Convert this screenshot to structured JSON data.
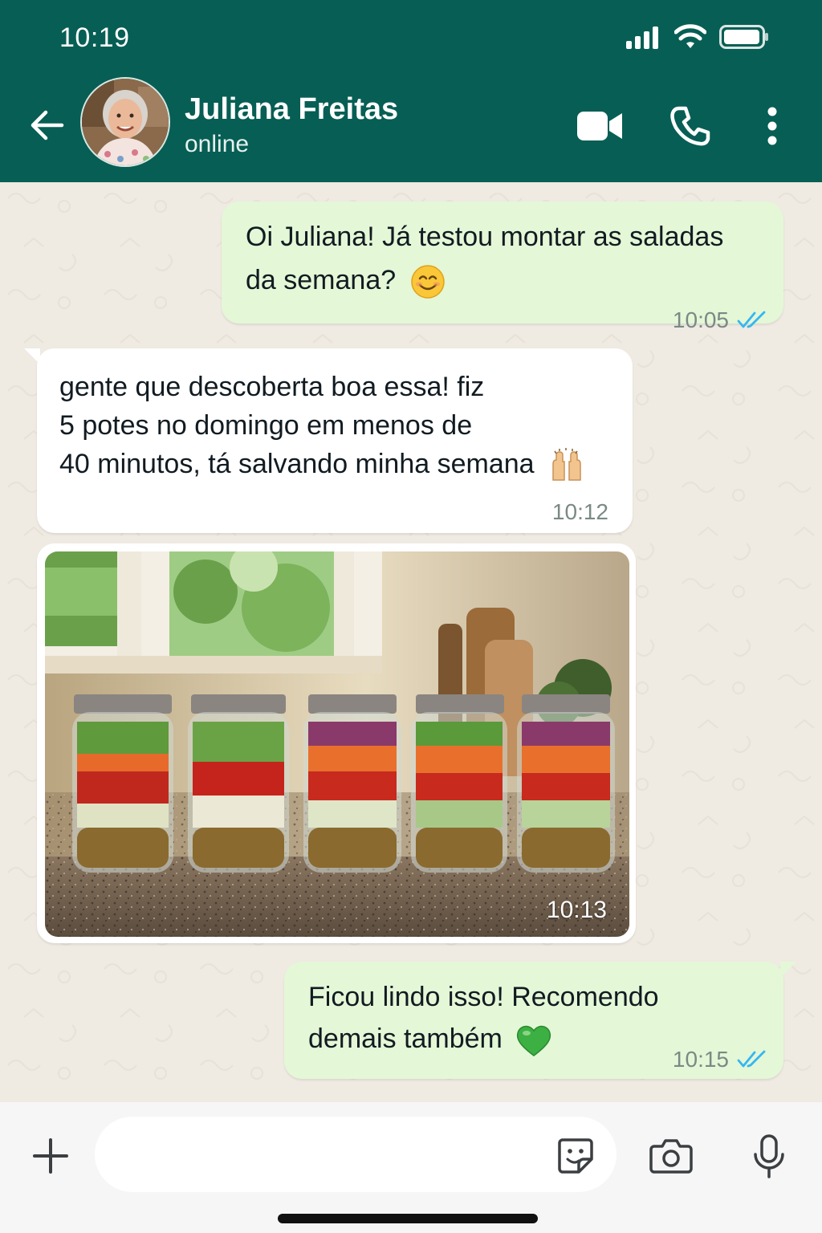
{
  "status_bar": {
    "time": "10:19"
  },
  "header": {
    "contact_name": "Juliana Freitas",
    "contact_status": "online",
    "icons": [
      "back-arrow-icon",
      "video-camera-icon",
      "phone-icon",
      "more-vert-icon"
    ]
  },
  "messages": [
    {
      "direction": "outgoing",
      "line1": "Oi Juliana! Já testou montar as saladas",
      "line2": "da semana?",
      "emoji": "smiling-face",
      "time": "10:05",
      "status": "read"
    },
    {
      "direction": "incoming",
      "line1": "gente que descoberta boa essa! fiz",
      "line2": "5 potes no domingo em menos de",
      "line3": "40 minutos, tá salvando minha semana",
      "emoji": "raising-hands",
      "time": "10:12"
    },
    {
      "direction": "incoming",
      "type": "image",
      "image_description_icon": "salad-jars-photo",
      "time": "10:13"
    },
    {
      "direction": "outgoing",
      "line1": "Ficou lindo isso! Recomendo",
      "line2": "demais também",
      "emoji": "green-heart",
      "time": "10:15",
      "status": "read"
    }
  ],
  "input_bar": {
    "placeholder": ""
  },
  "colors": {
    "header": "#075e54",
    "outgoing_bubble": "#e4f7d7",
    "incoming_bubble": "#ffffff",
    "read_ticks": "#34b7f1",
    "chat_bg": "#efeae2"
  }
}
